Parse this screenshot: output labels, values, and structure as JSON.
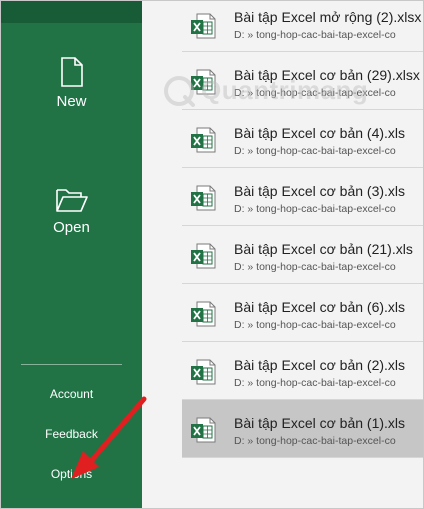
{
  "sidebar": {
    "new_label": "New",
    "open_label": "Open",
    "account_label": "Account",
    "feedback_label": "Feedback",
    "options_label": "Options"
  },
  "files": [
    {
      "name": "Bài tập Excel mở rộng  (2).xlsx",
      "path": "D: » tong-hop-cac-bai-tap-excel-co"
    },
    {
      "name": "Bài tập Excel cơ bản  (29).xlsx",
      "path": "D: » tong-hop-cac-bai-tap-excel-co"
    },
    {
      "name": "Bài tập Excel cơ bản  (4).xls",
      "path": "D: » tong-hop-cac-bai-tap-excel-co"
    },
    {
      "name": "Bài tập Excel cơ bản  (3).xls",
      "path": "D: » tong-hop-cac-bai-tap-excel-co"
    },
    {
      "name": "Bài tập Excel cơ bản  (21).xls",
      "path": "D: » tong-hop-cac-bai-tap-excel-co"
    },
    {
      "name": "Bài tập Excel cơ bản  (6).xls",
      "path": "D: » tong-hop-cac-bai-tap-excel-co"
    },
    {
      "name": "Bài tập Excel cơ bản  (2).xls",
      "path": "D: » tong-hop-cac-bai-tap-excel-co"
    },
    {
      "name": "Bài tập Excel cơ bản  (1).xls",
      "path": "D: » tong-hop-cac-bai-tap-excel-co",
      "selected": true
    }
  ],
  "watermark": "Quantrimang",
  "colors": {
    "sidebar_green": "#217346",
    "sidebar_top": "#185c37",
    "list_background": "#f3f3f3",
    "selected_row": "#c6c6c6",
    "arrow_red": "#e02020"
  },
  "icons": {
    "new": "new-document-icon",
    "open": "open-folder-icon",
    "file": "excel-file-icon"
  }
}
